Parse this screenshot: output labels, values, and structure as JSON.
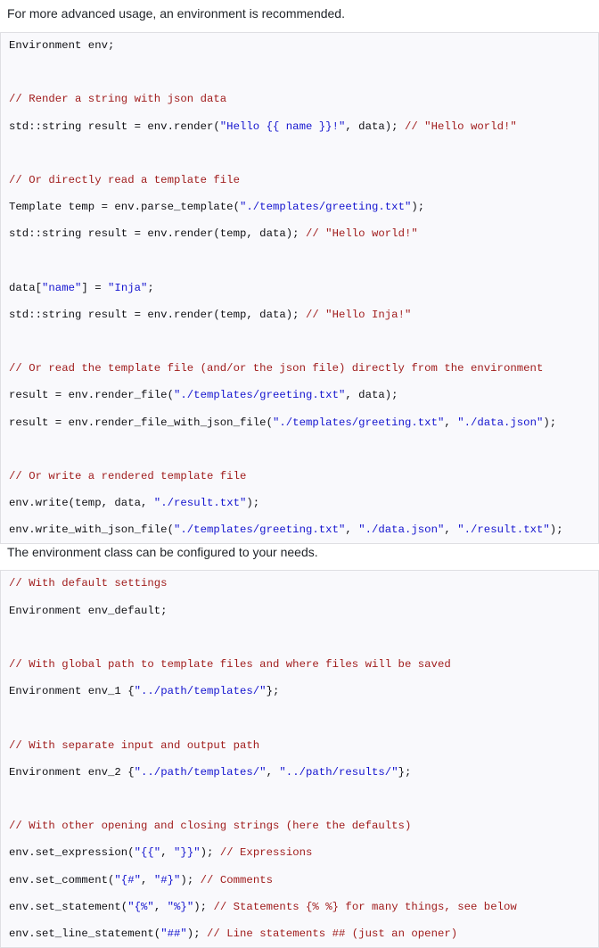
{
  "document": {
    "paragraphs": {
      "intro": "For more advanced usage, an environment is recommended.",
      "config": "The environment class can be configured to your needs."
    },
    "colors": {
      "code_background": "#f9f9fc",
      "code_border": "#dfdfe3",
      "comment": "#a01c1c",
      "string": "#1414cf",
      "plain_code": "#101014",
      "prose_text": "#1f2328",
      "page_background": "#ffffff"
    },
    "code_blocks": [
      {
        "id": "environment-usage",
        "language": "cpp",
        "lines": [
          [
            {
              "t": "plain",
              "s": "Environment env;"
            }
          ],
          [],
          [
            {
              "t": "comment",
              "s": "// Render a string with json data"
            }
          ],
          [
            {
              "t": "plain",
              "s": "std::string result = env.render("
            },
            {
              "t": "string",
              "s": "\"Hello {{ name }}!\""
            },
            {
              "t": "plain",
              "s": ", data); "
            },
            {
              "t": "comment",
              "s": "// \"Hello world!\""
            }
          ],
          [],
          [
            {
              "t": "comment",
              "s": "// Or directly read a template file"
            }
          ],
          [
            {
              "t": "plain",
              "s": "Template temp = env.parse_template("
            },
            {
              "t": "string",
              "s": "\"./templates/greeting.txt\""
            },
            {
              "t": "plain",
              "s": ");"
            }
          ],
          [
            {
              "t": "plain",
              "s": "std::string result = env.render(temp, data); "
            },
            {
              "t": "comment",
              "s": "// \"Hello world!\""
            }
          ],
          [],
          [
            {
              "t": "plain",
              "s": "data["
            },
            {
              "t": "string",
              "s": "\"name\""
            },
            {
              "t": "plain",
              "s": "] = "
            },
            {
              "t": "string",
              "s": "\"Inja\""
            },
            {
              "t": "plain",
              "s": ";"
            }
          ],
          [
            {
              "t": "plain",
              "s": "std::string result = env.render(temp, data); "
            },
            {
              "t": "comment",
              "s": "// \"Hello Inja!\""
            }
          ],
          [],
          [
            {
              "t": "comment",
              "s": "// Or read the template file (and/or the json file) directly from the environment"
            }
          ],
          [
            {
              "t": "plain",
              "s": "result = env.render_file("
            },
            {
              "t": "string",
              "s": "\"./templates/greeting.txt\""
            },
            {
              "t": "plain",
              "s": ", data);"
            }
          ],
          [
            {
              "t": "plain",
              "s": "result = env.render_file_with_json_file("
            },
            {
              "t": "string",
              "s": "\"./templates/greeting.txt\""
            },
            {
              "t": "plain",
              "s": ", "
            },
            {
              "t": "string",
              "s": "\"./data.json\""
            },
            {
              "t": "plain",
              "s": ");"
            }
          ],
          [],
          [
            {
              "t": "comment",
              "s": "// Or write a rendered template file"
            }
          ],
          [
            {
              "t": "plain",
              "s": "env.write(temp, data, "
            },
            {
              "t": "string",
              "s": "\"./result.txt\""
            },
            {
              "t": "plain",
              "s": ");"
            }
          ],
          [
            {
              "t": "plain",
              "s": "env.write_with_json_file("
            },
            {
              "t": "string",
              "s": "\"./templates/greeting.txt\""
            },
            {
              "t": "plain",
              "s": ", "
            },
            {
              "t": "string",
              "s": "\"./data.json\""
            },
            {
              "t": "plain",
              "s": ", "
            },
            {
              "t": "string",
              "s": "\"./result.txt\""
            },
            {
              "t": "plain",
              "s": ");"
            }
          ]
        ]
      },
      {
        "id": "environment-configuration",
        "language": "cpp",
        "lines": [
          [
            {
              "t": "comment",
              "s": "// With default settings"
            }
          ],
          [
            {
              "t": "plain",
              "s": "Environment env_default;"
            }
          ],
          [],
          [
            {
              "t": "comment",
              "s": "// With global path to template files and where files will be saved"
            }
          ],
          [
            {
              "t": "plain",
              "s": "Environment env_1 {"
            },
            {
              "t": "string",
              "s": "\"../path/templates/\""
            },
            {
              "t": "plain",
              "s": "};"
            }
          ],
          [],
          [
            {
              "t": "comment",
              "s": "// With separate input and output path"
            }
          ],
          [
            {
              "t": "plain",
              "s": "Environment env_2 {"
            },
            {
              "t": "string",
              "s": "\"../path/templates/\""
            },
            {
              "t": "plain",
              "s": ", "
            },
            {
              "t": "string",
              "s": "\"../path/results/\""
            },
            {
              "t": "plain",
              "s": "};"
            }
          ],
          [],
          [
            {
              "t": "comment",
              "s": "// With other opening and closing strings (here the defaults)"
            }
          ],
          [
            {
              "t": "plain",
              "s": "env.set_expression("
            },
            {
              "t": "string",
              "s": "\"{{\""
            },
            {
              "t": "plain",
              "s": ", "
            },
            {
              "t": "string",
              "s": "\"}}\""
            },
            {
              "t": "plain",
              "s": "); "
            },
            {
              "t": "comment",
              "s": "// Expressions"
            }
          ],
          [
            {
              "t": "plain",
              "s": "env.set_comment("
            },
            {
              "t": "string",
              "s": "\"{#\""
            },
            {
              "t": "plain",
              "s": ", "
            },
            {
              "t": "string",
              "s": "\"#}\""
            },
            {
              "t": "plain",
              "s": "); "
            },
            {
              "t": "comment",
              "s": "// Comments"
            }
          ],
          [
            {
              "t": "plain",
              "s": "env.set_statement("
            },
            {
              "t": "string",
              "s": "\"{%\""
            },
            {
              "t": "plain",
              "s": ", "
            },
            {
              "t": "string",
              "s": "\"%}\""
            },
            {
              "t": "plain",
              "s": "); "
            },
            {
              "t": "comment",
              "s": "// Statements {% %} for many things, see below"
            }
          ],
          [
            {
              "t": "plain",
              "s": "env.set_line_statement("
            },
            {
              "t": "string",
              "s": "\"##\""
            },
            {
              "t": "plain",
              "s": "); "
            },
            {
              "t": "comment",
              "s": "// Line statements ## (just an opener)"
            }
          ]
        ]
      }
    ]
  }
}
